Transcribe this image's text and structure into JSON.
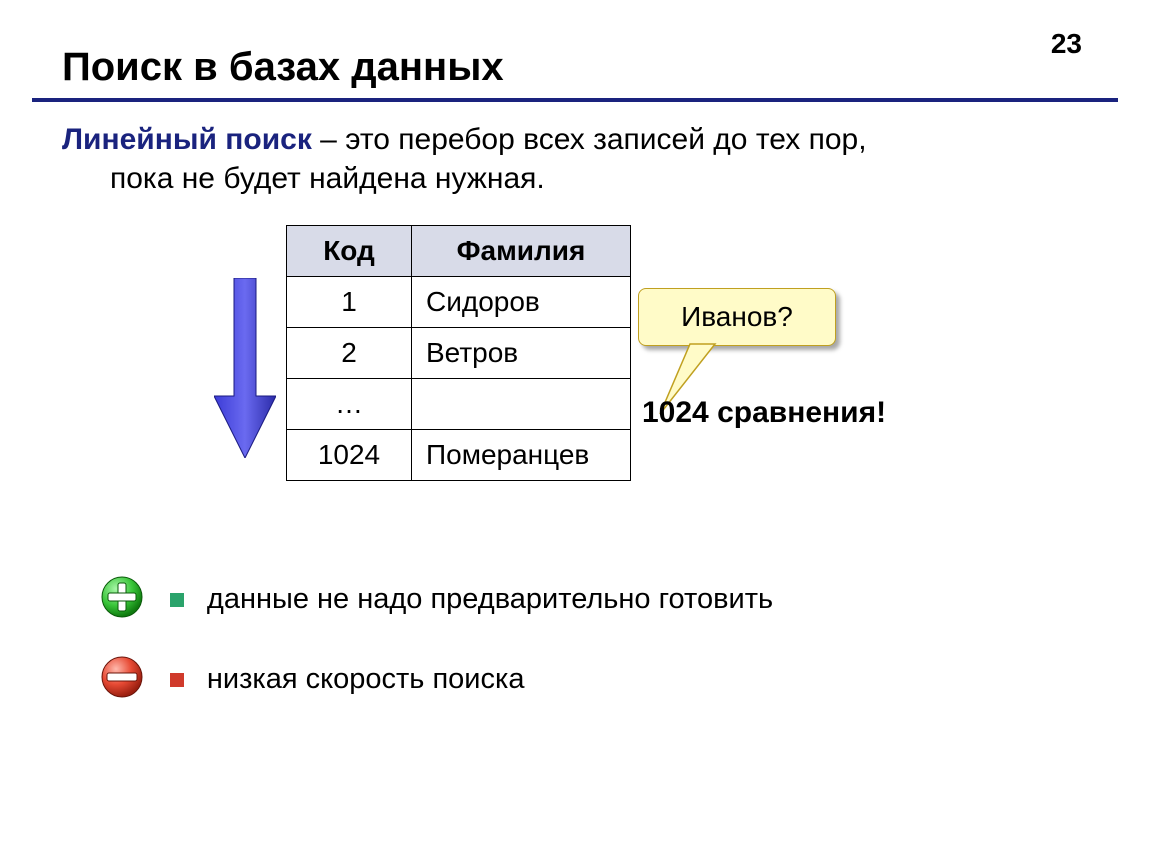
{
  "page_number": "23",
  "title": "Поиск в базах данных",
  "definition": {
    "term": "Линейный поиск",
    "rest_line1": " – это перебор всех записей до тех пор,",
    "rest_line2": "пока не будет найдена нужная."
  },
  "table": {
    "headers": {
      "code": "Код",
      "name": "Фамилия"
    },
    "rows": [
      {
        "code": "1",
        "name": "Сидоров"
      },
      {
        "code": "2",
        "name": "Ветров"
      },
      {
        "code": "…",
        "name": ""
      },
      {
        "code": "1024",
        "name": "Померанцев"
      }
    ]
  },
  "callout_text": "Иванов?",
  "comparisons_text": "1024 сравнения!",
  "points": {
    "pro": "данные не надо предварительно готовить",
    "con": "низкая скорость поиска"
  },
  "icons": {
    "down_arrow": "down-arrow-icon",
    "plus": "plus-circle-icon",
    "minus": "minus-circle-icon"
  },
  "colors": {
    "rule": "#1a237e",
    "term": "#1a237e",
    "callout_bg": "#fffbc8",
    "plus_green": "#3fbf3f",
    "minus_red": "#e23b2e"
  }
}
